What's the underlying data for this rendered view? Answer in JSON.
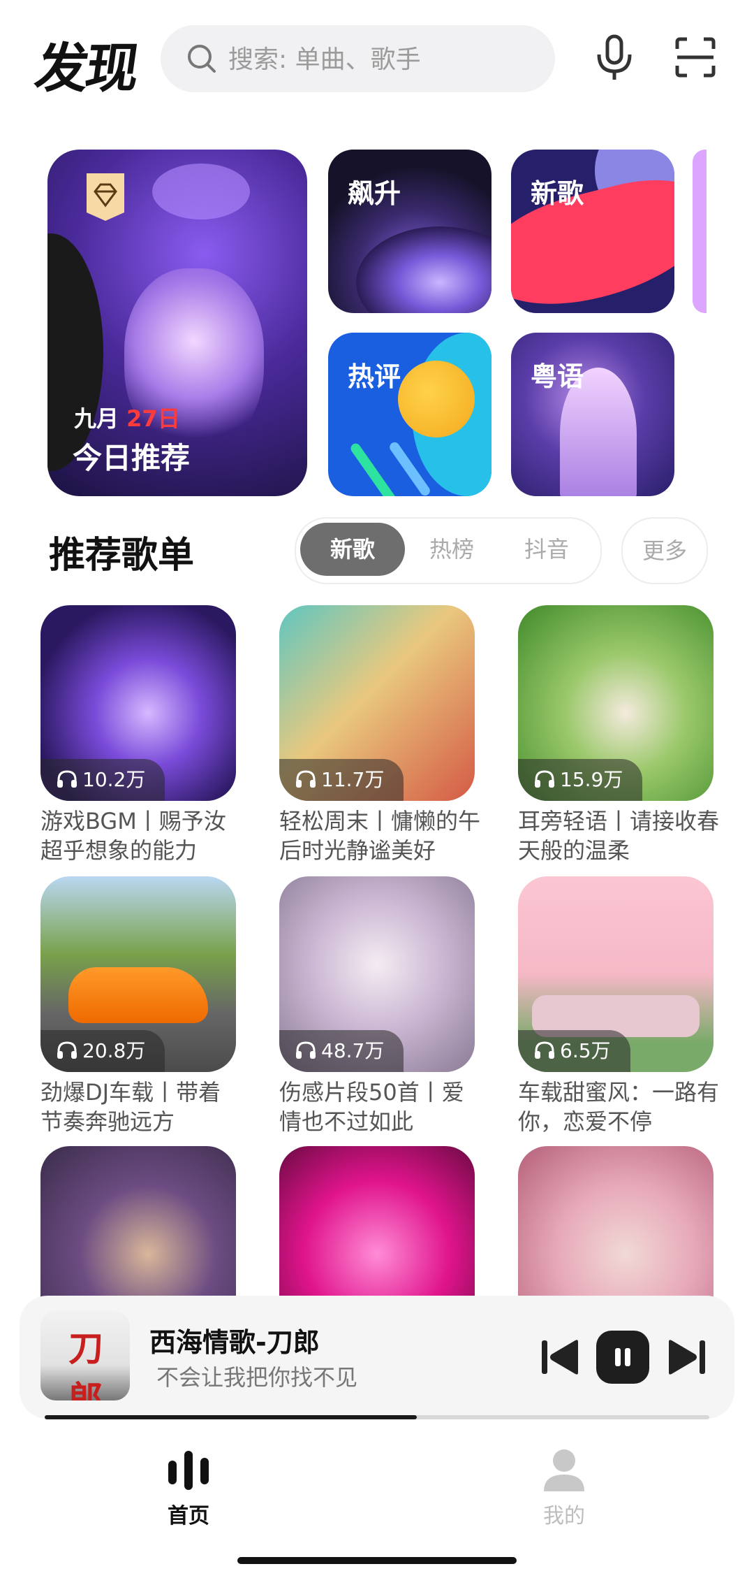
{
  "header": {
    "title": "发现",
    "search_placeholder": "搜索: 单曲、歌手",
    "icons": [
      "search-icon",
      "microphone-icon",
      "scan-icon"
    ]
  },
  "featured": {
    "daily": {
      "month": "九月",
      "day": "27日",
      "title": "今日推荐"
    },
    "tiles": [
      {
        "label": "飙升"
      },
      {
        "label": "新歌"
      },
      {
        "label": "热评"
      },
      {
        "label": "粤语"
      }
    ]
  },
  "playlists": {
    "section_title": "推荐歌单",
    "tabs": [
      "新歌",
      "热榜",
      "抖音"
    ],
    "active_tab": "新歌",
    "more_label": "更多",
    "items": [
      {
        "plays": "10.2万",
        "title": "游戏BGM丨赐予汝超乎想象的能力"
      },
      {
        "plays": "11.7万",
        "title": "轻松周末丨慵懒的午后时光静谧美好"
      },
      {
        "plays": "15.9万",
        "title": "耳旁轻语丨请接收春天般的温柔"
      },
      {
        "plays": "20.8万",
        "title": "劲爆DJ车载丨带着节奏奔驰远方"
      },
      {
        "plays": "48.7万",
        "title": "伤感片段50首丨爱情也不过如此"
      },
      {
        "plays": "6.5万",
        "title": "车载甜蜜风：一路有你，恋爱不停"
      },
      {
        "plays": "",
        "title": ""
      },
      {
        "plays": "",
        "title": ""
      },
      {
        "plays": "",
        "title": ""
      }
    ]
  },
  "player": {
    "song": "西海情歌-刀郎",
    "lyric": "不会让我把你找不见",
    "thumb_text": "刀郎",
    "progress": 0.56
  },
  "nav": {
    "items": [
      {
        "label": "首页",
        "active": true
      },
      {
        "label": "我的",
        "active": false
      }
    ]
  },
  "colors": {
    "accent": "#111111",
    "tab_active_bg": "#6e6e6e",
    "daily_day": "#ff3b3b",
    "inactive": "#bdbdbd"
  }
}
